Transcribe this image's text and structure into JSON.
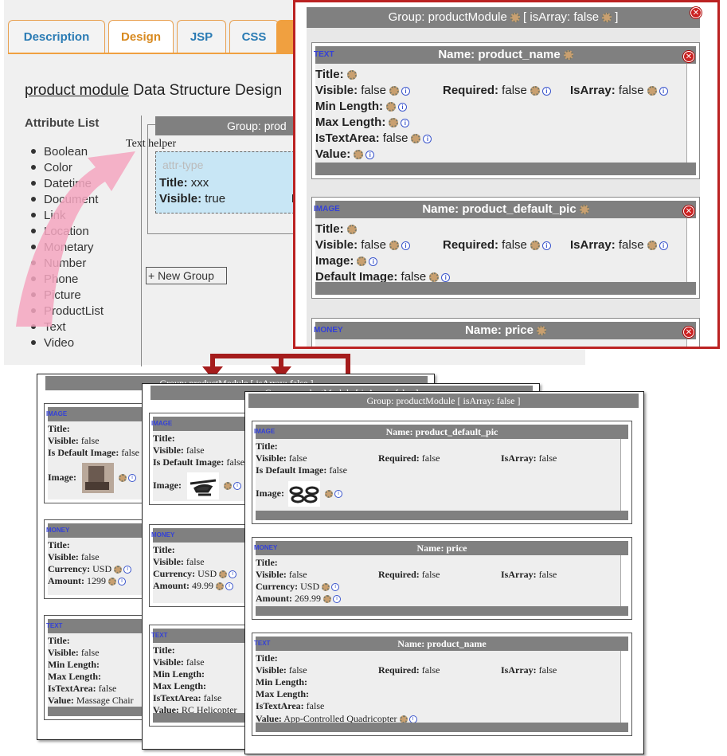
{
  "tabs": [
    "Description",
    "Design",
    "JSP",
    "CSS"
  ],
  "design_title_link": "product module",
  "design_title_rest": "Data Structure Design",
  "attribute_list_title": "Attribute List",
  "attributes": [
    "Boolean",
    "Color",
    "Datetime",
    "Document",
    "Link",
    "Location",
    "Monetary",
    "Number",
    "Phone",
    "Picture",
    "ProductList",
    "Text",
    "Video"
  ],
  "group_partial": "Group: prod",
  "text_helper": "Text helper",
  "helper_placeholder": "attr-type",
  "helper_title": {
    "label": "Title:",
    "value": " xxx"
  },
  "helper_visible": {
    "label": "Visible:",
    "value": " true"
  },
  "helper_trailing": "R",
  "new_group": "+ New Group",
  "popup": {
    "title": "Group: productModule",
    "isarray": "[ isArray: false",
    "isarray_close": "]",
    "cards": [
      {
        "tag": "TEXT",
        "name": "Name: product_name",
        "rows": [
          [
            "Title:",
            ""
          ],
          [
            "Visible:",
            " false",
            "Required:",
            " false",
            "IsArray:",
            " false"
          ],
          [
            "Min Length:",
            ""
          ],
          [
            "Max Length:",
            ""
          ],
          [
            "IsTextArea:",
            " false"
          ],
          [
            "Value:",
            ""
          ]
        ]
      },
      {
        "tag": "IMAGE",
        "name": "Name: product_default_pic",
        "rows": [
          [
            "Title:",
            ""
          ],
          [
            "Visible:",
            " false",
            "Required:",
            " false",
            "IsArray:",
            " false"
          ],
          [
            "Image:",
            ""
          ],
          [
            "Default Image:",
            " false"
          ]
        ]
      },
      {
        "tag": "MONEY",
        "name": "Name: price"
      }
    ]
  },
  "win1": {
    "head": "Group: productModule [ isArray: false ]",
    "cards": [
      {
        "tag": "IMAGE",
        "rows": [
          [
            "Title:",
            ""
          ],
          [
            "Visible:",
            " false"
          ],
          [
            "Is Default Image:",
            " false"
          ],
          [
            "Image:",
            ""
          ]
        ]
      },
      {
        "tag": "MONEY",
        "rows": [
          [
            "Title:",
            ""
          ],
          [
            "Visible:",
            " false"
          ],
          [
            "Currency:",
            " USD"
          ],
          [
            "Amount:",
            " 1299"
          ]
        ]
      },
      {
        "tag": "TEXT",
        "rows": [
          [
            "Title:",
            ""
          ],
          [
            "Visible:",
            " false"
          ],
          [
            "Min Length:",
            ""
          ],
          [
            "Max Length:",
            ""
          ],
          [
            "IsTextArea:",
            " false"
          ],
          [
            "Value:",
            " Massage Chair"
          ]
        ]
      }
    ]
  },
  "win2": {
    "head": "Group: productModule [ isArray: false ]",
    "cards": [
      {
        "tag": "IMAGE",
        "rows": [
          [
            "Title:",
            ""
          ],
          [
            "Visible:",
            " false"
          ],
          [
            "Is Default Image:",
            " false"
          ],
          [
            "Image:",
            ""
          ]
        ]
      },
      {
        "tag": "MONEY",
        "rows": [
          [
            "Title:",
            ""
          ],
          [
            "Visible:",
            " false"
          ],
          [
            "Currency:",
            " USD"
          ],
          [
            "Amount:",
            " 49.99"
          ]
        ]
      },
      {
        "tag": "TEXT",
        "rows": [
          [
            "Title:",
            ""
          ],
          [
            "Visible:",
            " false"
          ],
          [
            "Min Length:",
            ""
          ],
          [
            "Max Length:",
            ""
          ],
          [
            "IsTextArea:",
            " false"
          ],
          [
            "Value:",
            " RC Helicopter"
          ]
        ]
      }
    ]
  },
  "win3": {
    "head": "Group: productModule [ isArray: false ]",
    "cards": [
      {
        "tag": "IMAGE",
        "name": "Name: product_default_pic",
        "rows": [
          [
            "Title:",
            ""
          ],
          [
            "Visible:",
            " false",
            "Required:",
            " false",
            "IsArray:",
            " false"
          ],
          [
            "Is Default Image:",
            " false"
          ],
          [
            "Image:",
            ""
          ]
        ]
      },
      {
        "tag": "MONEY",
        "name": "Name: price",
        "rows": [
          [
            "Title:",
            ""
          ],
          [
            "Visible:",
            " false",
            "Required:",
            " false",
            "IsArray:",
            " false"
          ],
          [
            "Currency:",
            " USD"
          ],
          [
            "Amount:",
            " 269.99"
          ]
        ]
      },
      {
        "tag": "TEXT",
        "name": "Name: product_name",
        "rows": [
          [
            "Title:",
            ""
          ],
          [
            "Visible:",
            " false",
            "Required:",
            " false",
            "IsArray:",
            " false"
          ],
          [
            "Min Length:",
            ""
          ],
          [
            "Max Length:",
            ""
          ],
          [
            "IsTextArea:",
            " false"
          ],
          [
            "Value:",
            " App-Controlled Quadricopter"
          ]
        ]
      }
    ]
  },
  "colors": {
    "accent_orange": "#f0a040",
    "tab_blue": "#2a7bb4",
    "popup_border": "#b22222",
    "header_gray": "#808080",
    "tag_blue": "#3340d8"
  }
}
